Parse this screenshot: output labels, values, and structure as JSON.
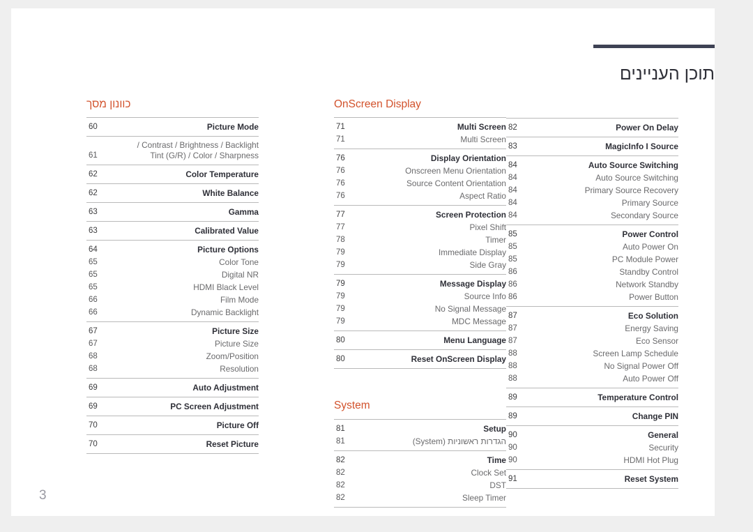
{
  "document": {
    "title": "תוכן העניינים",
    "folio": "3",
    "accent_color": "#d2522c",
    "rule_color": "#3e4254"
  },
  "columns": [
    {
      "id": "right",
      "heading": "כוונון מסך",
      "heading_rtl": true,
      "groups": [
        {
          "rows": [
            {
              "page": "60",
              "label": "Picture Mode",
              "level": "parent"
            }
          ]
        },
        {
          "rows": [
            {
              "page": "61",
              "label": "/ Contrast / Brightness / Backlight\nTint (G/R) / Color / Sharpness",
              "level": "child",
              "multiline": true
            }
          ]
        },
        {
          "rows": [
            {
              "page": "62",
              "label": "Color Temperature",
              "level": "parent"
            }
          ]
        },
        {
          "rows": [
            {
              "page": "62",
              "label": "White Balance",
              "level": "parent"
            }
          ]
        },
        {
          "rows": [
            {
              "page": "63",
              "label": "Gamma",
              "level": "parent"
            }
          ]
        },
        {
          "rows": [
            {
              "page": "63",
              "label": "Calibrated Value",
              "level": "parent"
            }
          ]
        },
        {
          "rows": [
            {
              "page": "64",
              "label": "Picture Options",
              "level": "parent"
            },
            {
              "page": "65",
              "label": "Color Tone",
              "level": "child"
            },
            {
              "page": "65",
              "label": "Digital NR",
              "level": "child"
            },
            {
              "page": "65",
              "label": "HDMI Black Level",
              "level": "child"
            },
            {
              "page": "66",
              "label": "Film Mode",
              "level": "child"
            },
            {
              "page": "66",
              "label": "Dynamic Backlight",
              "level": "child"
            }
          ]
        },
        {
          "rows": [
            {
              "page": "67",
              "label": "Picture Size",
              "level": "parent"
            },
            {
              "page": "67",
              "label": "Picture Size",
              "level": "child"
            },
            {
              "page": "68",
              "label": "Zoom/Position",
              "level": "child"
            },
            {
              "page": "68",
              "label": "Resolution",
              "level": "child"
            }
          ]
        },
        {
          "rows": [
            {
              "page": "69",
              "label": "Auto Adjustment",
              "level": "parent"
            }
          ]
        },
        {
          "rows": [
            {
              "page": "69",
              "label": "PC Screen Adjustment",
              "level": "parent"
            }
          ]
        },
        {
          "rows": [
            {
              "page": "70",
              "label": "Picture Off",
              "level": "parent"
            }
          ]
        },
        {
          "last": true,
          "rows": [
            {
              "page": "70",
              "label": "Reset Picture",
              "level": "parent"
            }
          ]
        }
      ]
    },
    {
      "id": "middle",
      "heading": "OnScreen Display",
      "heading_rtl": false,
      "groups": [
        {
          "rows": [
            {
              "page": "71",
              "label": "Multi Screen",
              "level": "parent"
            },
            {
              "page": "71",
              "label": "Multi Screen",
              "level": "child"
            }
          ]
        },
        {
          "rows": [
            {
              "page": "76",
              "label": "Display Orientation",
              "level": "parent"
            },
            {
              "page": "76",
              "label": "Onscreen Menu Orientation",
              "level": "child"
            },
            {
              "page": "76",
              "label": "Source Content Orientation",
              "level": "child"
            },
            {
              "page": "76",
              "label": "Aspect Ratio",
              "level": "child"
            }
          ]
        },
        {
          "rows": [
            {
              "page": "77",
              "label": "Screen Protection",
              "level": "parent"
            },
            {
              "page": "77",
              "label": "Pixel Shift",
              "level": "child"
            },
            {
              "page": "78",
              "label": "Timer",
              "level": "child"
            },
            {
              "page": "79",
              "label": "Immediate Display",
              "level": "child"
            },
            {
              "page": "79",
              "label": "Side Gray",
              "level": "child"
            }
          ]
        },
        {
          "rows": [
            {
              "page": "79",
              "label": "Message Display",
              "level": "parent"
            },
            {
              "page": "79",
              "label": "Source Info",
              "level": "child"
            },
            {
              "page": "79",
              "label": "No Signal Message",
              "level": "child"
            },
            {
              "page": "79",
              "label": "MDC Message",
              "level": "child"
            }
          ]
        },
        {
          "rows": [
            {
              "page": "80",
              "label": "Menu Language",
              "level": "parent"
            }
          ]
        },
        {
          "last": true,
          "rows": [
            {
              "page": "80",
              "label": "Reset OnScreen Display",
              "level": "parent"
            }
          ]
        }
      ],
      "second_heading": "System",
      "second_heading_rtl": false,
      "second_groups": [
        {
          "rows": [
            {
              "page": "81",
              "label": "Setup",
              "level": "parent"
            },
            {
              "page": "81",
              "label": "הגדרות ראשוניות (System)",
              "level": "child",
              "hebrew": true
            }
          ]
        },
        {
          "last": true,
          "rows": [
            {
              "page": "82",
              "label": "Time",
              "level": "parent"
            },
            {
              "page": "82",
              "label": "Clock Set",
              "level": "child"
            },
            {
              "page": "82",
              "label": "DST",
              "level": "child"
            },
            {
              "page": "82",
              "label": "Sleep Timer",
              "level": "child"
            }
          ]
        }
      ]
    },
    {
      "id": "left",
      "heading": "",
      "heading_rtl": false,
      "groups": [
        {
          "first_no_rule": true,
          "rows": [
            {
              "page": "82",
              "label": "Power On Delay",
              "level": "parent"
            }
          ]
        },
        {
          "rows": [
            {
              "page": "83",
              "label": "MagicInfo I Source",
              "level": "parent"
            }
          ]
        },
        {
          "rows": [
            {
              "page": "84",
              "label": "Auto Source Switching",
              "level": "parent"
            },
            {
              "page": "84",
              "label": "Auto Source Switching",
              "level": "child"
            },
            {
              "page": "84",
              "label": "Primary Source Recovery",
              "level": "child"
            },
            {
              "page": "84",
              "label": "Primary Source",
              "level": "child"
            },
            {
              "page": "84",
              "label": "Secondary Source",
              "level": "child"
            }
          ]
        },
        {
          "rows": [
            {
              "page": "85",
              "label": "Power Control",
              "level": "parent"
            },
            {
              "page": "85",
              "label": "Auto Power On",
              "level": "child"
            },
            {
              "page": "85",
              "label": "PC Module Power",
              "level": "child"
            },
            {
              "page": "86",
              "label": "Standby Control",
              "level": "child"
            },
            {
              "page": "86",
              "label": "Network Standby",
              "level": "child"
            },
            {
              "page": "86",
              "label": "Power Button",
              "level": "child"
            }
          ]
        },
        {
          "rows": [
            {
              "page": "87",
              "label": "Eco Solution",
              "level": "parent"
            },
            {
              "page": "87",
              "label": "Energy Saving",
              "level": "child"
            },
            {
              "page": "87",
              "label": "Eco Sensor",
              "level": "child"
            },
            {
              "page": "88",
              "label": "Screen Lamp Schedule",
              "level": "child"
            },
            {
              "page": "88",
              "label": "No Signal Power Off",
              "level": "child"
            },
            {
              "page": "88",
              "label": "Auto Power Off",
              "level": "child"
            }
          ]
        },
        {
          "rows": [
            {
              "page": "89",
              "label": "Temperature Control",
              "level": "parent"
            }
          ]
        },
        {
          "rows": [
            {
              "page": "89",
              "label": "Change PIN",
              "level": "parent"
            }
          ]
        },
        {
          "rows": [
            {
              "page": "90",
              "label": "General",
              "level": "parent"
            },
            {
              "page": "90",
              "label": "Security",
              "level": "child"
            },
            {
              "page": "90",
              "label": "HDMI Hot Plug",
              "level": "child"
            }
          ]
        },
        {
          "last": true,
          "rows": [
            {
              "page": "91",
              "label": "Reset System",
              "level": "parent"
            }
          ]
        }
      ]
    }
  ]
}
